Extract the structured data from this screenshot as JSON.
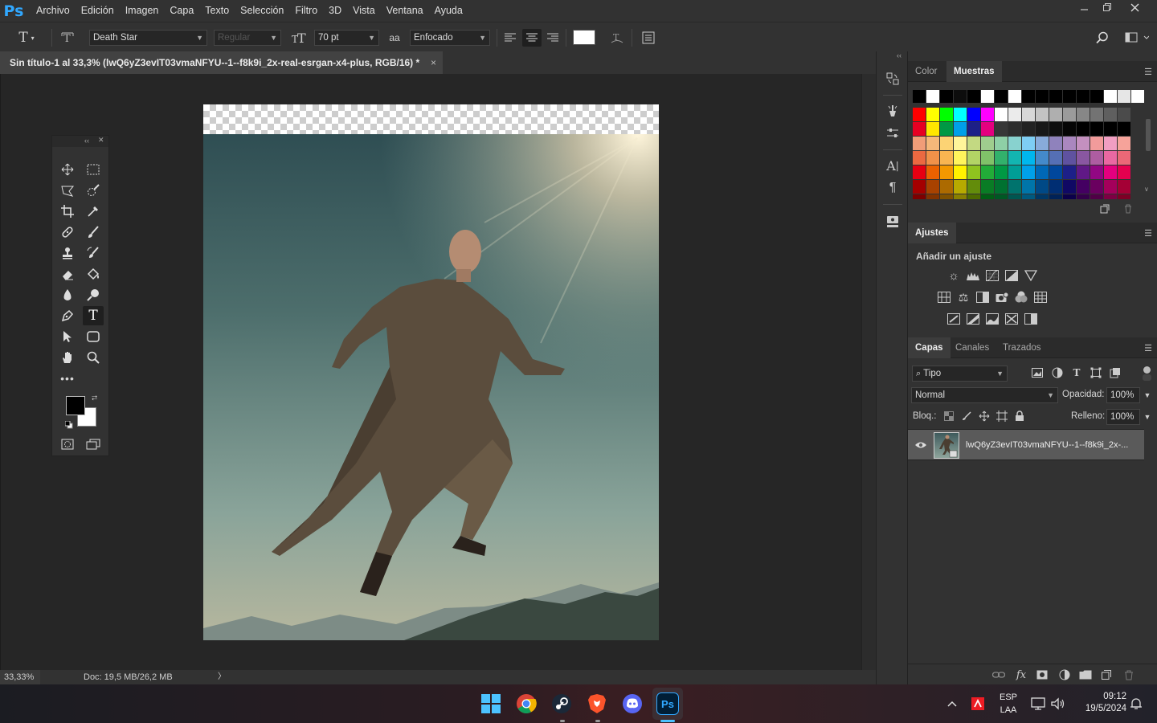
{
  "app": {
    "logo": "Ps"
  },
  "menubar": {
    "items": [
      "Archivo",
      "Edición",
      "Imagen",
      "Capa",
      "Texto",
      "Selección",
      "Filtro",
      "3D",
      "Vista",
      "Ventana",
      "Ayuda"
    ],
    "window_buttons": [
      "minimize-icon",
      "restore-icon",
      "close-icon"
    ]
  },
  "options": {
    "font_family": "Death Star",
    "font_style_placeholder": "Regular",
    "font_size": "70 pt",
    "antialias_icon": "aa",
    "antialias": "Enfocado",
    "text_color": "#ffffff"
  },
  "document": {
    "tab_title": "Sin título-1 al 33,3% (lwQ6yZ3evIT03vmaNFYU--1--f8k9i_2x-real-esrgan-x4-plus, RGB/16) *",
    "close": "×"
  },
  "status": {
    "zoom": "33,33%",
    "doc": "Doc: 19,5 MB/26,2 MB",
    "arrow": "〉"
  },
  "panels": {
    "color_tabs": [
      "Color",
      "Muestras"
    ],
    "swatch_rows": [
      [
        "#000000",
        "#ffffff",
        "#000000",
        "#0d0d0d",
        "#000000",
        "#ffffff",
        "#000000",
        "#ffffff",
        "#000000",
        "#000000",
        "#000000",
        "#000000",
        "#000000",
        "#000000",
        "#ffffff",
        "#e6e6e6",
        "#ffffff"
      ],
      [
        "#ff0000",
        "#ffff00",
        "#00ff00",
        "#00ffff",
        "#0000ff",
        "#ff00ff",
        "#ffffff",
        "#ebebeb",
        "#d7d7d7",
        "#c3c3c3",
        "#afafaf",
        "#9b9b9b",
        "#878787",
        "#737373",
        "#5f5f5f",
        "#4b4b4b"
      ],
      [
        "#e60022",
        "#ffe600",
        "#009944",
        "#00a0e9",
        "#1d2088",
        "#e4007f",
        "#373737",
        "#2d2d2d",
        "#222222",
        "#181818",
        "#0e0e0e",
        "#050505",
        "#000000",
        "#000000",
        "#000000",
        "#000000"
      ],
      [
        "#f19d78",
        "#f5b87a",
        "#fcd374",
        "#fff59a",
        "#c3d982",
        "#9fcd8e",
        "#8ecfa6",
        "#88d2cf",
        "#7ecef4",
        "#88abda",
        "#8f82bc",
        "#aa87bf",
        "#c490bf",
        "#f29b9b",
        "#f19ec2",
        "#f6a39a"
      ],
      [
        "#ec6941",
        "#f19149",
        "#f8b551",
        "#fff45c",
        "#b3d465",
        "#80c269",
        "#32b16c",
        "#13b5b1",
        "#00b7ee",
        "#448aca",
        "#556fb5",
        "#5f52a0",
        "#8957a1",
        "#ae5da1",
        "#ea68a2",
        "#eb6877"
      ],
      [
        "#e60012",
        "#eb6100",
        "#f39800",
        "#fff100",
        "#8fc31f",
        "#22ac38",
        "#009944",
        "#009e96",
        "#00a0e9",
        "#0068b7",
        "#00479d",
        "#1d2088",
        "#601986",
        "#920783",
        "#e4007f",
        "#e5004f"
      ],
      [
        "#a40000",
        "#a84200",
        "#ac6a00",
        "#b7aa00",
        "#638c0b",
        "#097c25",
        "#007130",
        "#00736d",
        "#0075a9",
        "#004986",
        "#002e73",
        "#100964",
        "#440062",
        "#6a005f",
        "#a4005b",
        "#a40035"
      ],
      [
        "#7d0000",
        "#823300",
        "#7f5100",
        "#898000",
        "#4e6b00",
        "#005e15",
        "#005824",
        "#005651",
        "#00597f",
        "#003765",
        "#002257",
        "#0b004a",
        "#33004a",
        "#500046",
        "#7d0043",
        "#7d0025"
      ]
    ],
    "ajustes_tab": "Ajustes",
    "ajustes_subtitle": "Añadir un ajuste",
    "layers_tabs": [
      "Capas",
      "Canales",
      "Trazados"
    ],
    "filter_kind": "Tipo",
    "blend_mode": "Normal",
    "opacity_label": "Opacidad:",
    "opacity_value": "100%",
    "lock_label": "Bloq.:",
    "fill_label": "Relleno:",
    "fill_value": "100%",
    "layer_name": "lwQ6yZ3evIT03vmaNFYU--1--f8k9i_2x-..."
  },
  "taskbar": {
    "lang_top": "ESP",
    "lang_bottom": "LAA",
    "time": "09:12",
    "date": "19/5/2024",
    "ps_label": "Ps"
  }
}
